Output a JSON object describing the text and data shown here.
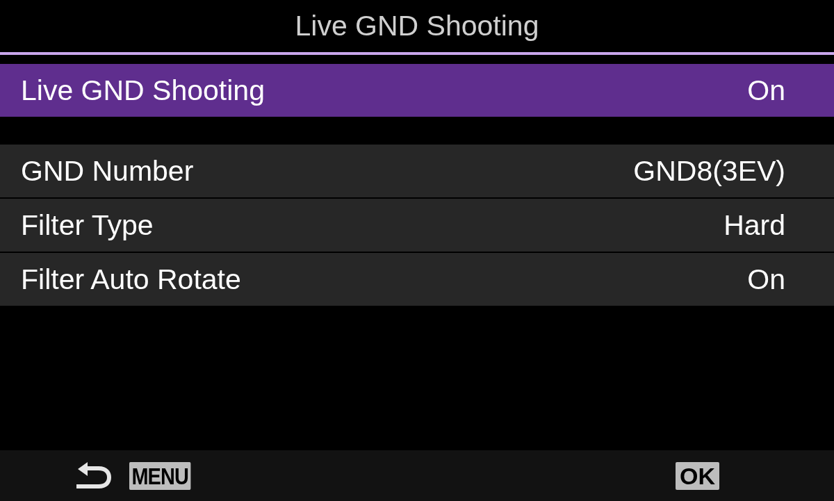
{
  "title": "Live GND Shooting",
  "groups": [
    {
      "items": [
        {
          "label": "Live GND Shooting",
          "value": "On",
          "selected": true
        }
      ]
    },
    {
      "items": [
        {
          "label": "GND Number",
          "value": "GND8(3EV)",
          "selected": false
        },
        {
          "label": "Filter Type",
          "value": "Hard",
          "selected": false
        },
        {
          "label": "Filter Auto Rotate",
          "value": "On",
          "selected": false
        }
      ]
    }
  ],
  "footer": {
    "back_key": "MENU",
    "ok_key": "OK"
  }
}
